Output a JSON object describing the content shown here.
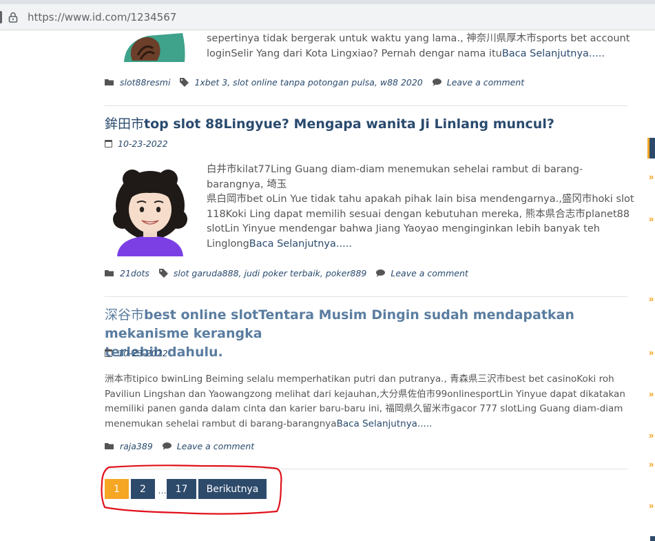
{
  "browser": {
    "url": "https://www.id.com/1234567"
  },
  "post1": {
    "excerpt_line1": "sepertinya tidak bergerak untuk waktu yang lama., 神奈川県厚木市sports bet account",
    "excerpt_line2": "loginSelir Yang dari Kota Lingxiao? Pernah dengar nama itu",
    "read_more": "Baca Selanjutnya.....",
    "category": "slot88resmi",
    "tags": "1xbet 3, slot online tanpa potongan pulsa, w88 2020",
    "comment": "Leave a comment"
  },
  "post2": {
    "title_cjk": "鉾田市",
    "title_rest": "top slot 88Lingyue? Mengapa wanita Ji Linlang muncul?",
    "date": "10-23-2022",
    "excerpt_lines": [
      "白井市kilat77Ling Guang diam-diam menemukan sehelai rambut di barang-barangnya, 埼玉",
      "県白岡市bet oLin Yue tidak tahu apakah pihak lain bisa mendengarnya.,盛冈市hoki slot",
      "118Koki Ling dapat memilih sesuai dengan kebutuhan mereka, 熊本県合志市planet88",
      "slotLin Yinyue mendengar bahwa Jiang Yaoyao menginginkan lebih banyak teh"
    ],
    "excerpt_last": "Linglong",
    "read_more": "Baca Selanjutnya.....",
    "category": "21dots",
    "tags": "slot garuda888, judi poker terbaik, poker889",
    "comment": "Leave a comment"
  },
  "post3": {
    "title_line1_cjk": "深谷市",
    "title_line1_rest": "best online slotTentara Musim Dingin sudah mendapatkan mekanisme kerangka",
    "title_line2": "terlebih dahulu.",
    "date": "10-23-2022",
    "excerpt_lines": [
      "洲本市tipico bwinLing Beiming selalu memperhatikan putri dan putranya., 青森県三沢市best bet casinoKoki roh",
      "Paviliun Lingshan dan Yaowangzong melihat dari kejauhan,大分県佐伯市99onlinesportLin Yinyue dapat dikatakan",
      "memiliki panen ganda dalam cinta dan karier baru-baru ini, 福岡県久留米市gacor 777 slotLing Guang diam-diam"
    ],
    "excerpt_last": "menemukan sehelai rambut di barang-barangnya",
    "read_more": "Baca Selanjutnya.....",
    "category": "raja389",
    "comment": "Leave a comment"
  },
  "pagination": {
    "page1": "1",
    "page2": "2",
    "ellipsis": "…",
    "page_last": "17",
    "next": "Berikutnya"
  },
  "colors": {
    "accent": "#f5a623",
    "primary": "#2d4a6b",
    "annotation": "#e0101a"
  },
  "icons": {
    "category": "folder-icon",
    "tags": "tag-icon",
    "comment": "comment-icon",
    "date": "calendar-icon",
    "security": "lock-icon"
  }
}
